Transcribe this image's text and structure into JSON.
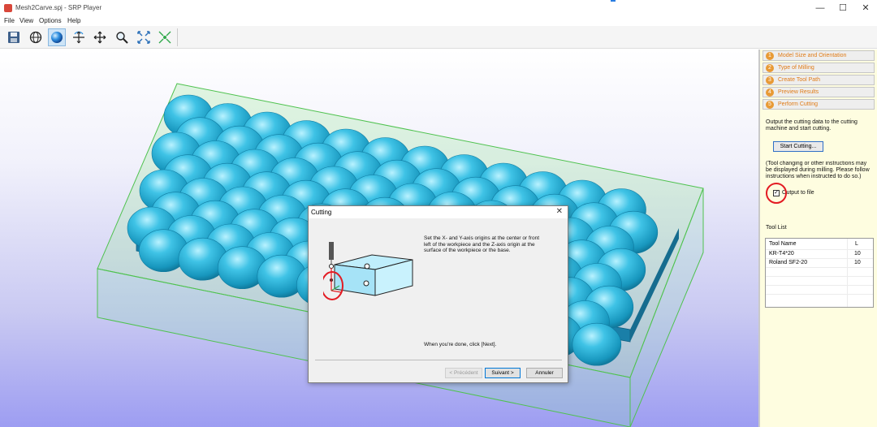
{
  "window": {
    "title": "Mesh2Carve.spj - SRP Player",
    "minimize": "—",
    "maximize": "☐",
    "close": "✕"
  },
  "menu": [
    "File",
    "View",
    "Options",
    "Help"
  ],
  "toolbar": {
    "buttons": [
      "save-icon",
      "globe-icon",
      "sphere-icon",
      "rotate-icon",
      "move-icon",
      "zoom-icon",
      "fit-icon",
      "fit-all-icon"
    ],
    "active": "sphere-icon"
  },
  "panel": {
    "steps": [
      {
        "num": "1",
        "label": "Model Size and Orientation"
      },
      {
        "num": "2",
        "label": "Type of Milling"
      },
      {
        "num": "3",
        "label": "Create Tool Path"
      },
      {
        "num": "4",
        "label": "Preview Results"
      },
      {
        "num": "5",
        "label": "Perform Cutting"
      }
    ],
    "intro": "Output the cutting data to the cutting machine and start cutting.",
    "start_button": "Start Cutting...",
    "note": "(Tool changing or other instructions may be displayed during milling. Please follow instructions when instructed to do so.)",
    "output_checkbox": {
      "label": "Output to file",
      "checked": true
    },
    "tool_list_title": "Tool List",
    "tool_list": {
      "headers": [
        "Tool Name",
        "L"
      ],
      "rows": [
        [
          "KR-T4*20",
          "10"
        ],
        [
          "Roland SF2-20",
          "10"
        ]
      ]
    }
  },
  "dialog": {
    "title": "Cutting",
    "close": "✕",
    "instruction": "Set the X- and Y-axis origins at the center or front left of the workpiece and the Z-axis origin at the surface of the workpiece or the base.",
    "done_text": "When you're done, click [Next].",
    "buttons": {
      "previous": "< Précédent",
      "next": "Suivant >",
      "cancel": "Annuler"
    }
  },
  "colors": {
    "accent_orange": "#e07b16",
    "panel_bg": "#fefde0",
    "model_blue": "#1fa7cc",
    "highlight_red": "#e31b23"
  }
}
